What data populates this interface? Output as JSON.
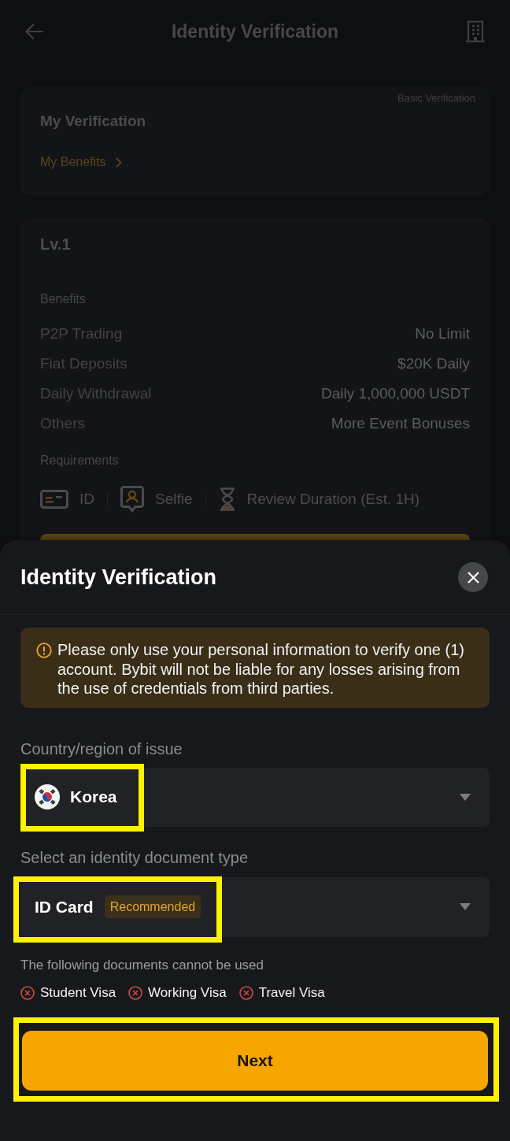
{
  "background_page": {
    "header": {
      "title": "Identity Verification"
    },
    "my_verification": {
      "title": "My Verification",
      "tag": "Basic Verification",
      "link": "My Benefits"
    },
    "level_card": {
      "title": "Lv.1",
      "benefits_label": "Benefits",
      "benefits": [
        {
          "label": "P2P Trading",
          "value": "No Limit"
        },
        {
          "label": "Fiat Deposits",
          "value": "$20K Daily"
        },
        {
          "label": "Daily Withdrawal",
          "value": "Daily 1,000,000 USDT"
        },
        {
          "label": "Others",
          "value": "More Event Bonuses"
        }
      ],
      "requirements_label": "Requirements",
      "requirements": [
        {
          "kind": "id",
          "label": "ID"
        },
        {
          "kind": "selfie",
          "label": "Selfie"
        },
        {
          "kind": "duration",
          "label": "Review Duration (Est. 1H)"
        }
      ]
    }
  },
  "sheet": {
    "title": "Identity Verification",
    "notice": "Please only use your personal information to verify one (1) account. Bybit will not be liable for any losses arising from the use of credentials from third parties.",
    "country": {
      "label": "Country/region of issue",
      "value": "Korea",
      "highlighted": true
    },
    "document_type": {
      "label": "Select an identity document type",
      "value": "ID Card",
      "tag": "Recommended",
      "highlighted": true
    },
    "excluded_label": "The following documents cannot be used",
    "excluded": [
      "Student Visa",
      "Working Visa",
      "Travel Visa"
    ],
    "next_button": {
      "label": "Next",
      "highlighted": true
    }
  }
}
